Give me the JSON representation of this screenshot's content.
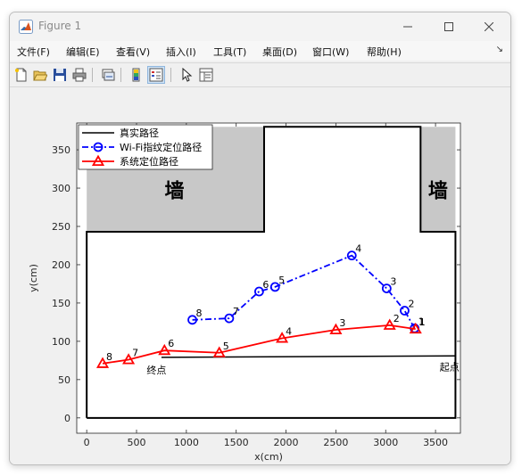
{
  "window": {
    "title": "Figure 1"
  },
  "menu": [
    "文件(F)",
    "编辑(E)",
    "查看(V)",
    "插入(I)",
    "工具(T)",
    "桌面(D)",
    "窗口(W)",
    "帮助(H)"
  ],
  "toolbar": [
    "new-figure",
    "open-file",
    "save",
    "print",
    "link-plot",
    "colorbar",
    "legend",
    "pointer-select",
    "property-inspector"
  ],
  "labels": {
    "wall": "墙",
    "start": "起点",
    "end": "终点"
  },
  "chart_data": {
    "type": "line",
    "xlabel": "x(cm)",
    "ylabel": "y(cm)",
    "xlim": [
      -100,
      3750
    ],
    "ylim": [
      -20,
      385
    ],
    "xticks": [
      0,
      500,
      1000,
      1500,
      2000,
      2500,
      3000,
      3500
    ],
    "yticks": [
      0,
      50,
      100,
      150,
      200,
      250,
      300,
      350
    ],
    "legend_position": "top-left",
    "series": [
      {
        "name": "真实路径",
        "color": "#000000",
        "style": "solid",
        "marker": "none",
        "x": [
          3700,
          750
        ],
        "y": [
          81,
          79
        ]
      },
      {
        "name": "Wi-Fi指纹定位路径",
        "color": "#0000ff",
        "style": "dashdot",
        "marker": "circle",
        "x": [
          3290,
          3190,
          3010,
          2660,
          1890,
          1730,
          1430,
          1060
        ],
        "y": [
          117,
          140,
          169,
          212,
          171,
          165,
          130,
          128
        ],
        "point_labels": [
          "1",
          "2",
          "3",
          "4",
          "5",
          "6",
          "7",
          "8"
        ]
      },
      {
        "name": "系统定位路径",
        "color": "#ff0000",
        "style": "solid",
        "marker": "triangle",
        "x": [
          3300,
          3040,
          2500,
          1960,
          1330,
          780,
          420,
          160
        ],
        "y": [
          116,
          121,
          115,
          104,
          85,
          88,
          76,
          71
        ],
        "point_labels": [
          "1",
          "2",
          "3",
          "4",
          "5",
          "6",
          "7",
          "8"
        ]
      }
    ]
  }
}
